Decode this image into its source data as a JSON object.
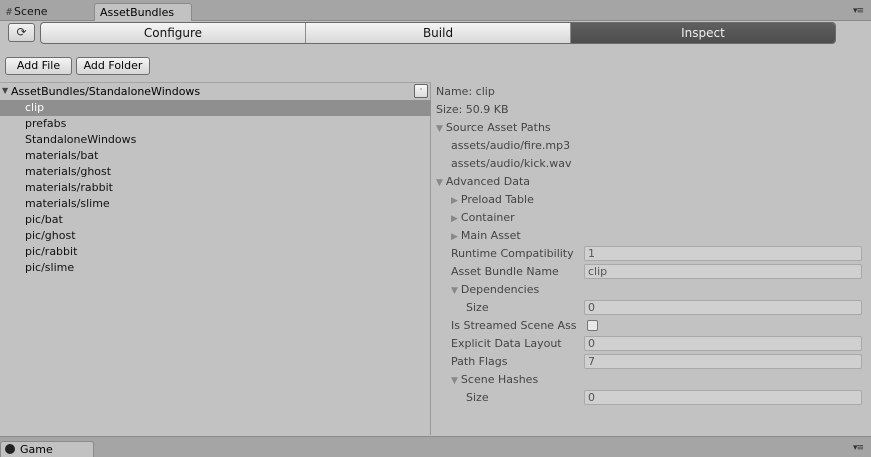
{
  "tabs": {
    "scene_label": "Scene",
    "assetbundles_label": "AssetBundles",
    "game_label": "Game"
  },
  "toolbar": {
    "refresh_icon": "refresh-icon",
    "modes": [
      "Configure",
      "Build",
      "Inspect"
    ],
    "selected_mode": "Inspect"
  },
  "buttons": {
    "add_file": "Add File",
    "add_folder": "Add Folder"
  },
  "tree": {
    "header": "AssetBundles/StandaloneWindows",
    "dropdown_glyph": "·",
    "items": [
      "clip",
      "prefabs",
      "StandaloneWindows",
      "materials/bat",
      "materials/ghost",
      "materials/rabbit",
      "materials/slime",
      "pic/bat",
      "pic/ghost",
      "pic/rabbit",
      "pic/slime"
    ],
    "selected": "clip"
  },
  "inspector": {
    "name": "Name: clip",
    "size": "Size: 50.9 KB",
    "source_asset_paths_label": "Source Asset Paths",
    "source_paths": [
      "assets/audio/fire.mp3",
      "assets/audio/kick.wav"
    ],
    "advanced_data_label": "Advanced Data",
    "preload_table_label": "Preload Table",
    "container_label": "Container",
    "main_asset_label": "Main Asset",
    "runtime_compat_label": "Runtime Compatibility",
    "runtime_compat_value": "1",
    "bundle_name_label": "Asset Bundle Name",
    "bundle_name_value": "clip",
    "dependencies_label": "Dependencies",
    "dep_size_label": "Size",
    "dep_size_value": "0",
    "streamed_label": "Is Streamed Scene Ass",
    "explicit_label": "Explicit Data Layout",
    "explicit_value": "0",
    "path_flags_label": "Path Flags",
    "path_flags_value": "7",
    "scene_hashes_label": "Scene Hashes",
    "scene_size_label": "Size",
    "scene_size_value": "0"
  },
  "colors": {
    "background": "#c2c2c2",
    "selected_row": "#8f8f8f",
    "selected_mode": "#565656"
  }
}
